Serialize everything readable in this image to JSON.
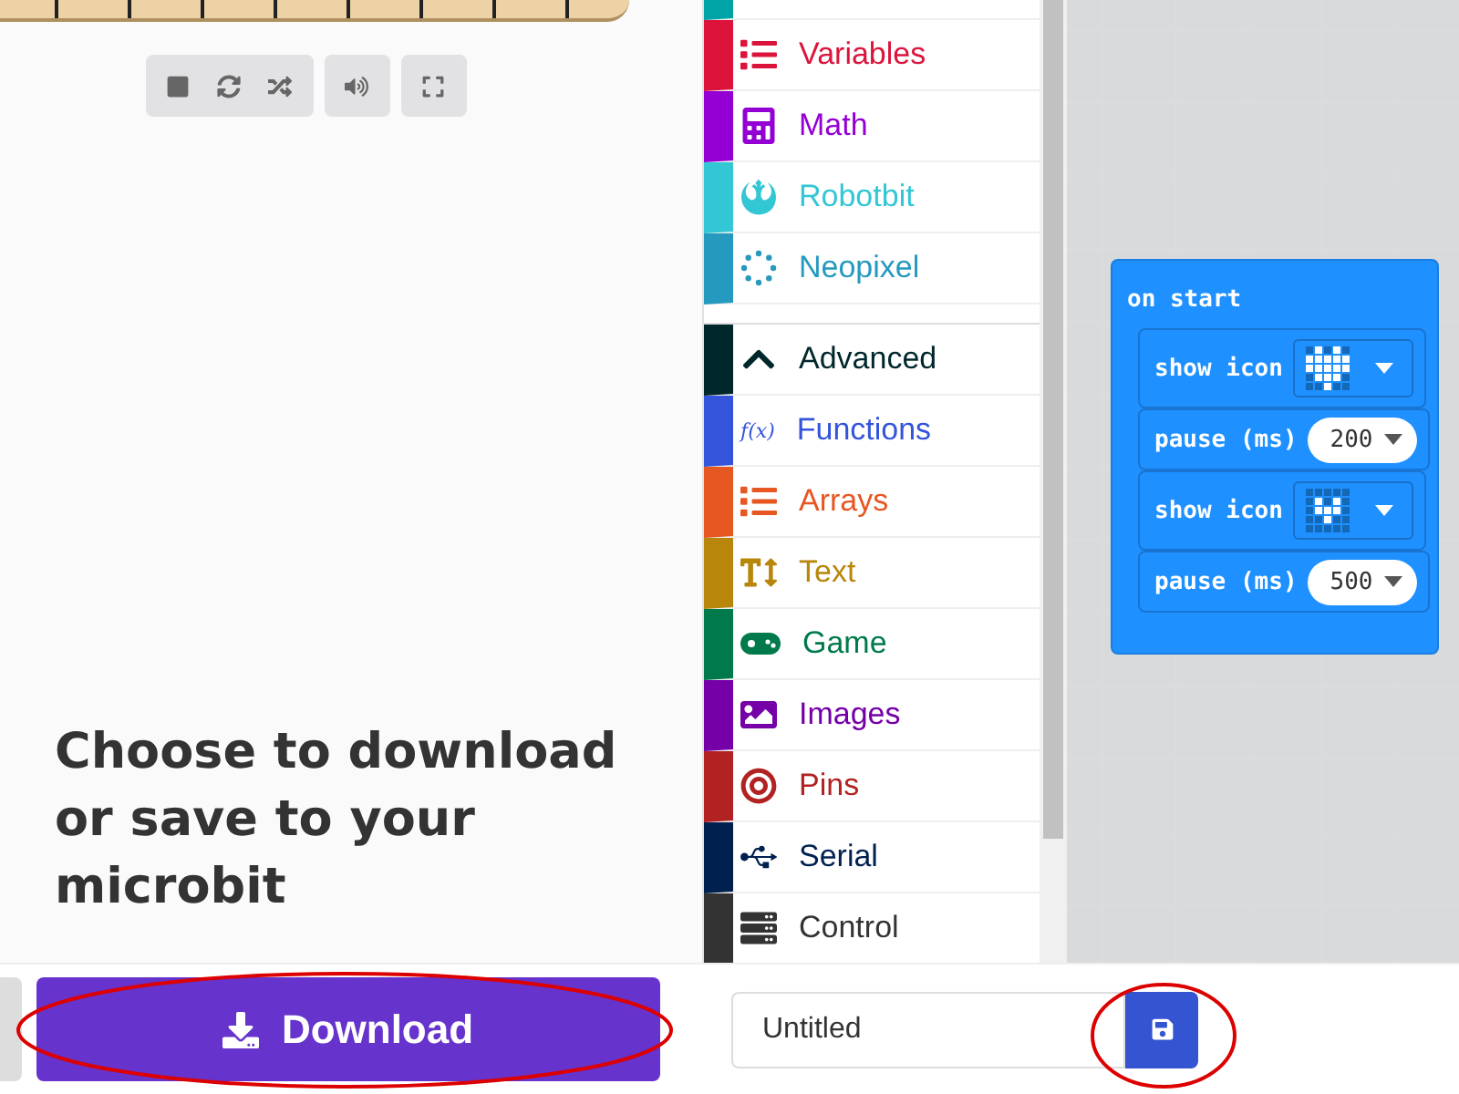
{
  "simulator": {
    "controls": [
      {
        "kind": "stop"
      },
      {
        "kind": "restart"
      },
      {
        "kind": "slow"
      },
      {
        "kind": "sound"
      },
      {
        "kind": "fullscreen"
      }
    ]
  },
  "message": "Choose to download or save to your microbit",
  "toolbox": {
    "categories": [
      {
        "color": "#00a4a6"
      },
      {
        "label": "Variables",
        "color": "#dc143c"
      },
      {
        "label": "Math",
        "color": "#9400d3"
      },
      {
        "label": "Robotbit",
        "color": "#33c6d5"
      },
      {
        "label": "Neopixel",
        "color": "#2699bf"
      },
      {
        "label": "Advanced",
        "color": "#00272b"
      },
      {
        "label": "Functions",
        "color": "#3455db",
        "symbol": "f(x)"
      },
      {
        "label": "Arrays",
        "color": "#e65722"
      },
      {
        "label": "Text",
        "color": "#b8860b"
      },
      {
        "label": "Game",
        "color": "#007a4b"
      },
      {
        "label": "Images",
        "color": "#7600a8"
      },
      {
        "label": "Pins",
        "color": "#b22222"
      },
      {
        "label": "Serial",
        "color": "#002050"
      },
      {
        "label": "Control",
        "color": "#333333"
      }
    ]
  },
  "workspace": {
    "event": "on start",
    "blocks": [
      {
        "kind": "show_icon",
        "label": "show icon",
        "leds": [
          [
            false,
            true,
            false,
            true,
            false
          ],
          [
            true,
            true,
            true,
            true,
            true
          ],
          [
            true,
            true,
            true,
            true,
            true
          ],
          [
            false,
            true,
            true,
            true,
            false
          ],
          [
            false,
            false,
            true,
            false,
            false
          ]
        ]
      },
      {
        "kind": "pause",
        "label": "pause (ms)",
        "value": "200"
      },
      {
        "kind": "show_icon",
        "label": "show icon",
        "leds": [
          [
            false,
            false,
            false,
            false,
            false
          ],
          [
            false,
            true,
            false,
            true,
            false
          ],
          [
            false,
            true,
            true,
            true,
            false
          ],
          [
            false,
            false,
            true,
            false,
            false
          ],
          [
            false,
            false,
            false,
            false,
            false
          ]
        ]
      },
      {
        "kind": "pause",
        "label": "pause (ms)",
        "value": "500"
      }
    ]
  },
  "download_button": "Download",
  "filename": {
    "value": "Untitled"
  }
}
